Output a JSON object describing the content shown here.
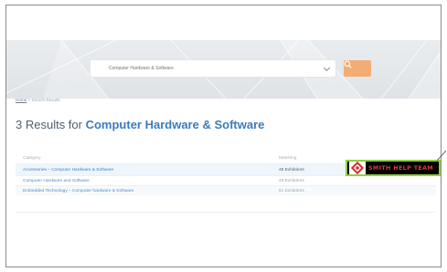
{
  "search": {
    "value": "Computer Hardware & Software",
    "button_icon": "search-icon"
  },
  "breadcrumb": {
    "home": "Home",
    "separator": ">",
    "current": "Search Results"
  },
  "results": {
    "count_prefix": "3 Results for ",
    "query": "Computer Hardware & Software"
  },
  "table": {
    "headers": [
      "Category",
      "Matching"
    ],
    "rows": [
      {
        "category": "Accessories – Computer Hardware & Software",
        "matching": "49 Exhibitors"
      },
      {
        "category": "Computer Hardware and Software",
        "matching": "46 Exhibitors"
      },
      {
        "category": "Embedded Technology – Computer hardware & Software",
        "matching": "61 Exhibitors"
      }
    ]
  },
  "overlay": {
    "label": "SMITH HELP TEAM",
    "colors": {
      "text": "#e23a3a",
      "border": "#90cf3f",
      "background": "#000000"
    }
  },
  "colors": {
    "accent_blue": "#3b7bbf",
    "button_orange": "#f3ad74"
  }
}
